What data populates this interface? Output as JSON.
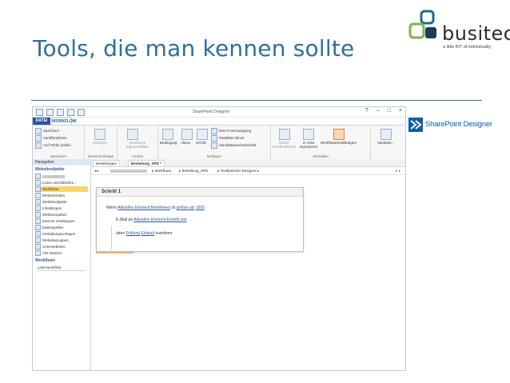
{
  "slide": {
    "title": "Tools, die man kennen sollte"
  },
  "logo": {
    "word": "busitec",
    "tagline": "a little BIT of individuality"
  },
  "product": {
    "name": "SharePoint Designer"
  },
  "app": {
    "window_title": "SharePoint Designer",
    "tabs": [
      "DATEI",
      "WORKFLOW"
    ],
    "ribbon": {
      "speichern_group": {
        "items": [
          "Speichern",
          "Veröffentlichen",
          "Auf Fehler prüfen"
        ],
        "label": "Speichern"
      },
      "zwischenablage_group": {
        "items": [
          "Einfügen"
        ],
        "label": "Zwischenablage"
      },
      "aendern_group": {
        "items": [
          "Erweiterte Eigenschaften"
        ],
        "label": "Ändern"
      },
      "einfuegen_group": {
        "items": [
          "Bedingung",
          "Aktion",
          "Schritt",
          "Else-If-Verzweigung",
          "Paralleler Block",
          "Identitätswechselschritt"
        ],
        "label": "Einfügen"
      },
      "verwalten_group": {
        "items": [
          "Global veröffentlichen",
          "In Visio exportieren",
          "Workfloweinstellungen",
          "Variablen"
        ],
        "label": "Verwalten"
      }
    },
    "nav": {
      "header": "Navigation",
      "section1": "Websiteobjekte",
      "items": [
        "Listen und Bibliothe...",
        "Workflows",
        "Websiteseiten",
        "Websiteobjekte",
        "Inhaltstypen",
        "Websitespalten",
        "Externe Inhaltstypen",
        "Datenquellen",
        "Gestaltungsvorlagen",
        "Websitegruppen",
        "Unterwebsites",
        "Alle Dateien"
      ],
      "section2": "Workflows",
      "section2_item": "Listenworkflow"
    },
    "doc_tabs": [
      "Bestellungen",
      "Bestellung_SPD *"
    ],
    "breadcrumb": [
      "Workflows",
      "Bestellung_SPD",
      "Textbasierter Designer"
    ],
    "step": {
      "title": "Schritt 1",
      "line1_prefix": "Wenn",
      "line1_link1": "Aktuelles Element:Bestellwert",
      "line1_mid": "ist",
      "line1_link2": "größer als",
      "line1_value": "1000",
      "line2_prefix": "E-Mail an",
      "line2_link": "Aktuelles Element:Erstellt von",
      "line3_prefix": "dann",
      "line3_link1": "Prüfung",
      "line3_link2": "Einkauf",
      "line3_suffix": "zuordnen"
    }
  }
}
